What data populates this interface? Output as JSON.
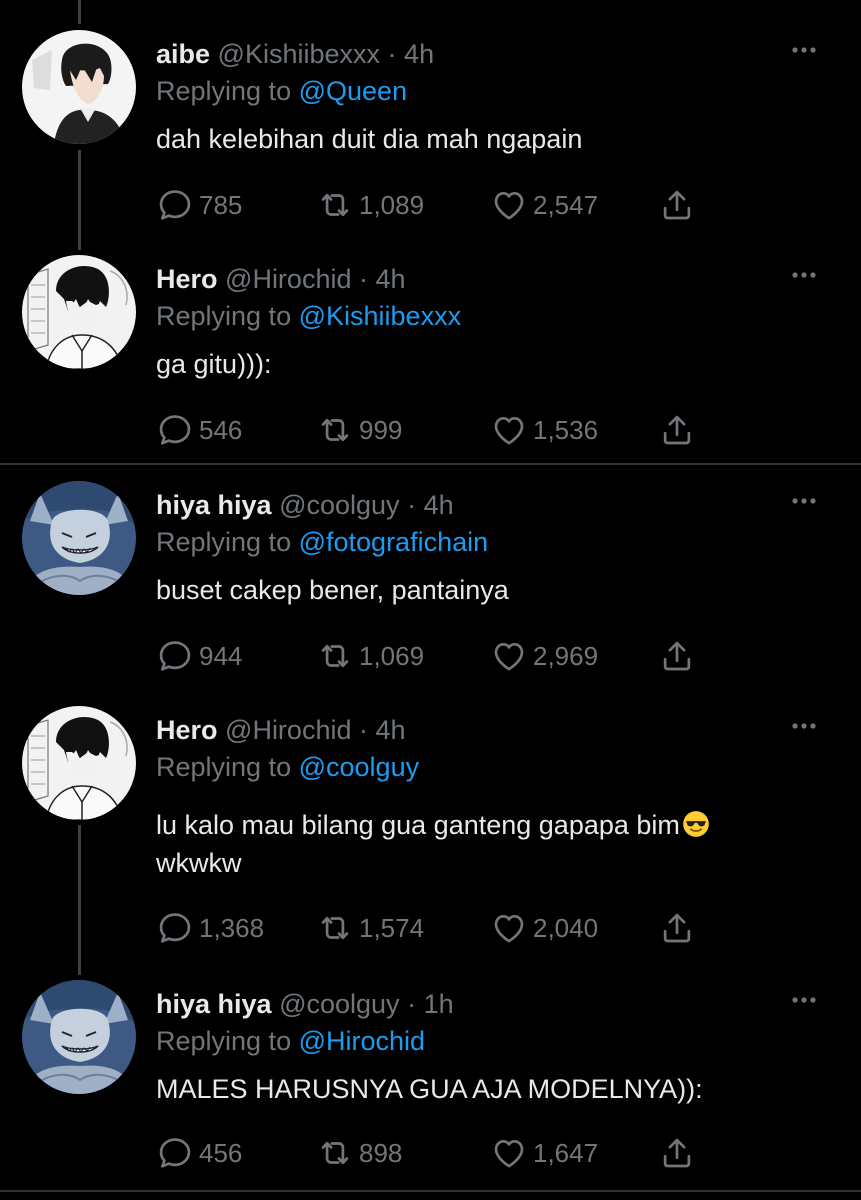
{
  "icons": {
    "reply": "speech-bubble-icon",
    "retweet": "retweet-arrows-icon",
    "like": "heart-icon",
    "share": "share-upload-icon",
    "more": "more-dots-icon",
    "emoji": "sunglasses-emoji"
  },
  "colors": {
    "background": "#000000",
    "text": "#e7e9ea",
    "muted": "#71767b",
    "accent": "#1d9bf0",
    "divider": "#2f3336"
  },
  "tweets": [
    {
      "name": "aibe",
      "handle": "@Kishiibexxx",
      "dot": "·",
      "time": "4h",
      "replying_prefix": "Replying to",
      "replying_to": "@Queen",
      "text": "dah kelebihan duit dia mah ngapain",
      "replies": "785",
      "retweets": "1,089",
      "likes": "2,547"
    },
    {
      "name": "Hero",
      "handle": "@Hirochid",
      "dot": "·",
      "time": "4h",
      "replying_prefix": "Replying to",
      "replying_to": "@Kishiibexxx",
      "text": "ga gitu))):",
      "replies": "546",
      "retweets": "999",
      "likes": "1,536"
    },
    {
      "name": "hiya hiya",
      "handle": "@coolguy",
      "dot": "·",
      "time": "4h",
      "replying_prefix": "Replying to",
      "replying_to": "@fotograficha in",
      "text": "buset cakep bener, pantainya",
      "replies": "944",
      "retweets": "1,069",
      "likes": "2,969"
    },
    {
      "name": "Hero",
      "handle": "@Hirochid",
      "dot": "·",
      "time": "4h",
      "replying_prefix": "Replying to",
      "replying_to": "@coolguy",
      "text_line1": "lu kalo mau bilang gua ganteng gapapa bim",
      "text_line2": "wkwkw",
      "replies": "1,368",
      "retweets": "1,574",
      "likes": "2,040"
    },
    {
      "name": "hiya hiya",
      "handle": "@coolguy",
      "dot": "·",
      "time": "1h",
      "replying_prefix": "Replying to",
      "replying_to": "@Hirochid",
      "text": "MALES HARUSNYA GUA AJA MODELNYA)):",
      "replies": "456",
      "retweets": "898",
      "likes": "1,647"
    }
  ]
}
